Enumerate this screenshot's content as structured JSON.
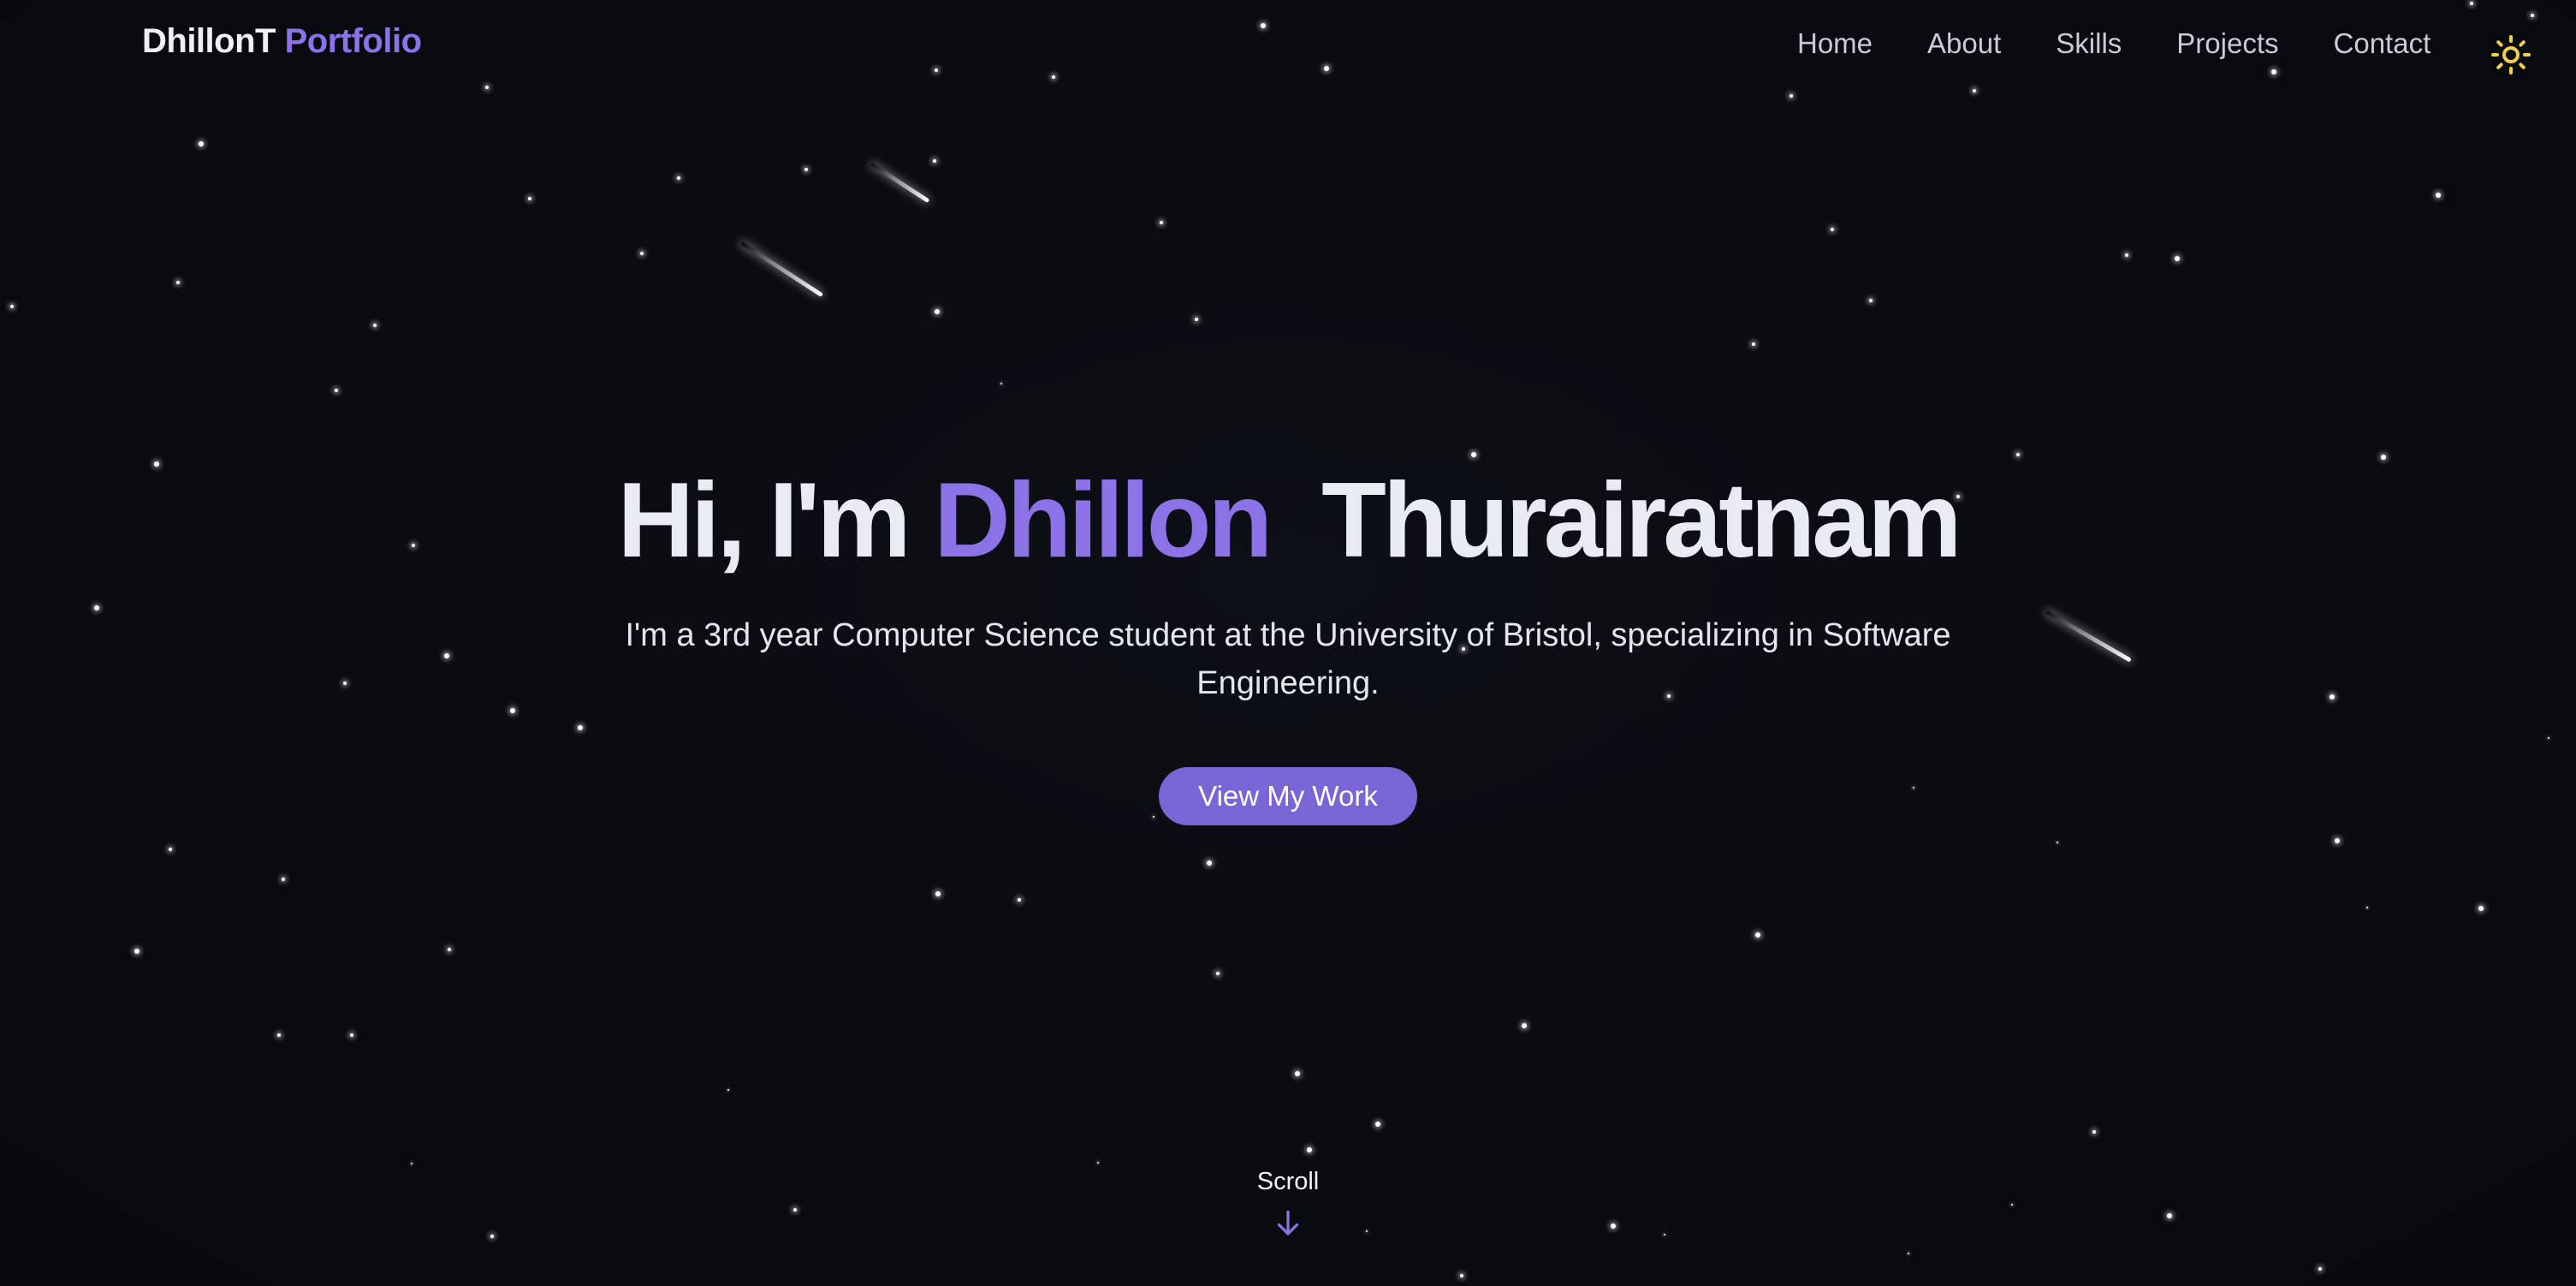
{
  "nav": {
    "logo_main": "DhillonT",
    "logo_accent": "Portfolio",
    "links": [
      "Home",
      "About",
      "Skills",
      "Projects",
      "Contact"
    ],
    "theme_toggle_icon": "sun-icon"
  },
  "hero": {
    "greeting": "Hi, I'm",
    "name_first": "Dhillon",
    "name_last": "Thurairatnam",
    "subtitle": "I'm a 3rd year Computer Science student at the University of Bristol, specializing in Software Engineering.",
    "cta_label": "View My Work"
  },
  "scroll": {
    "label": "Scroll",
    "icon": "arrow-down-icon"
  },
  "colors": {
    "background": "#0a0b10",
    "accent": "#8b72e6",
    "button": "#7a65d6",
    "sun": "#f2d14a"
  }
}
